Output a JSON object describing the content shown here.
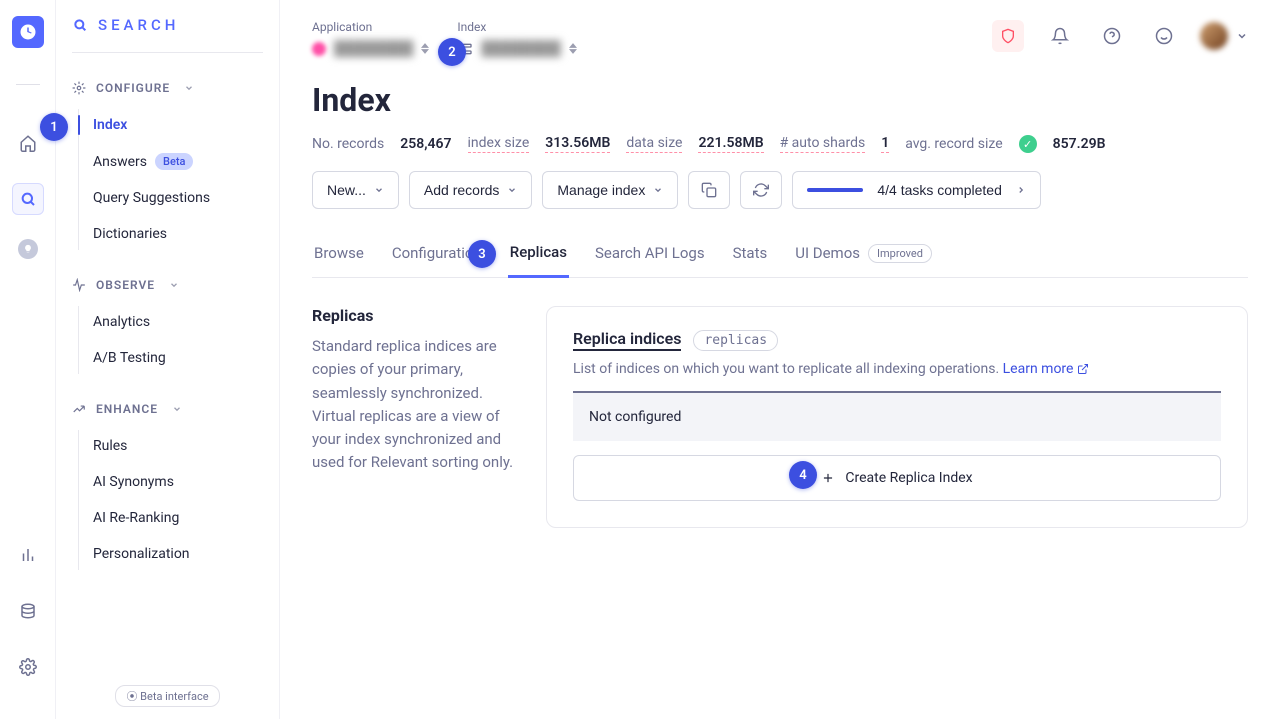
{
  "brand": "SEARCH",
  "rail": {
    "icons": [
      "home",
      "search",
      "help"
    ]
  },
  "sections": [
    {
      "name": "CONFIGURE",
      "icon": "gear",
      "items": [
        {
          "label": "Index",
          "active": true
        },
        {
          "label": "Answers",
          "badge": "Beta"
        },
        {
          "label": "Query Suggestions"
        },
        {
          "label": "Dictionaries"
        }
      ]
    },
    {
      "name": "OBSERVE",
      "icon": "pulse",
      "items": [
        {
          "label": "Analytics"
        },
        {
          "label": "A/B Testing"
        }
      ]
    },
    {
      "name": "ENHANCE",
      "icon": "trend",
      "items": [
        {
          "label": "Rules"
        },
        {
          "label": "AI Synonyms"
        },
        {
          "label": "AI Re-Ranking"
        },
        {
          "label": "Personalization"
        }
      ]
    }
  ],
  "beta_label": "⦿ Beta interface",
  "topbar": {
    "app_label": "Application",
    "index_label": "Index"
  },
  "page": {
    "title": "Index",
    "records_label": "No. records",
    "records": "258,467",
    "index_size_label": "index size",
    "index_size": "313.56MB",
    "data_size_label": "data size",
    "data_size": "221.58MB",
    "shards_label": "# auto shards",
    "shards": "1",
    "avg_label": "avg. record size",
    "avg": "857.29B"
  },
  "actions": {
    "new": "New...",
    "add": "Add records",
    "manage": "Manage index",
    "tasks": "4/4 tasks completed"
  },
  "tabs": [
    {
      "label": "Browse"
    },
    {
      "label": "Configuration"
    },
    {
      "label": "Replicas",
      "active": true
    },
    {
      "label": "Search API Logs"
    },
    {
      "label": "Stats"
    },
    {
      "label": "UI Demos",
      "badge": "Improved"
    }
  ],
  "replicas": {
    "side_title": "Replicas",
    "side_desc": "Standard replica indices are copies of your primary, seamlessly synchronized. Virtual replicas are a view of your index synchronized and used for Relevant sorting only.",
    "panel_title": "Replica indices",
    "code": "replicas",
    "desc": "List of indices on which you want to replicate all indexing operations.",
    "learn": "Learn more",
    "empty": "Not configured",
    "create": "Create Replica Index"
  },
  "annotations": [
    "1",
    "2",
    "3",
    "4"
  ]
}
